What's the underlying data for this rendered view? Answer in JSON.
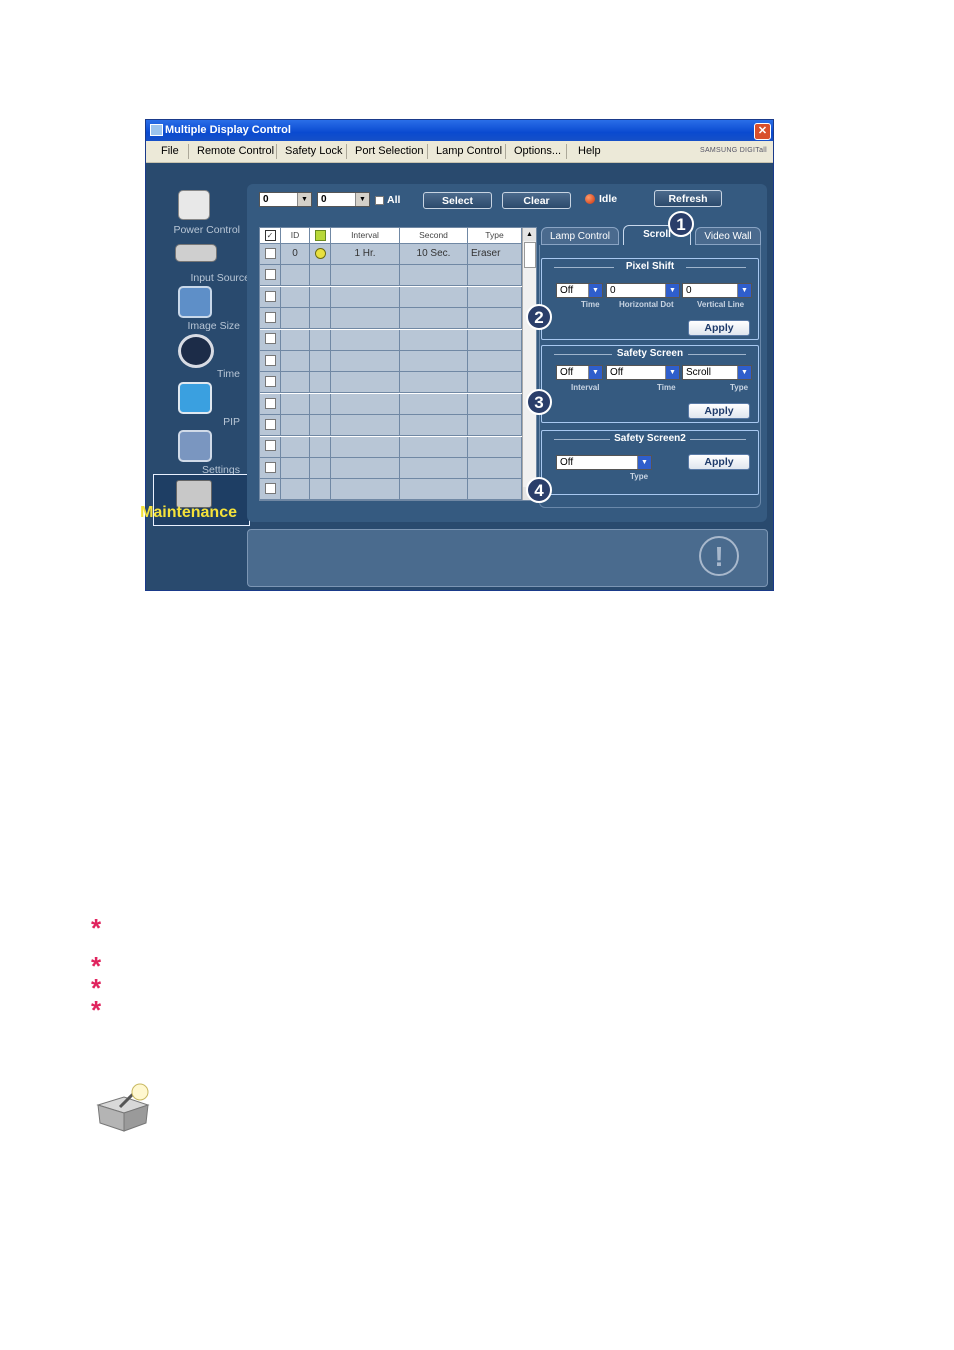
{
  "window": {
    "title": "Multiple Display Control",
    "close_glyph": "✕",
    "brand": "SAMSUNG DIGITall"
  },
  "menu": [
    "File",
    "Remote Control",
    "Safety Lock",
    "Port Selection",
    "Lamp Control",
    "Options...",
    "Help"
  ],
  "sidebar": [
    {
      "label": "Power Control",
      "icon": "power-control-icon"
    },
    {
      "label": "Input Source",
      "icon": "input-source-icon"
    },
    {
      "label": "Image Size",
      "icon": "image-size-icon"
    },
    {
      "label": "Time",
      "icon": "clock-icon"
    },
    {
      "label": "PIP",
      "icon": "pip-icon"
    },
    {
      "label": "Settings",
      "icon": "settings-icon"
    },
    {
      "label": "Maintenance",
      "icon": "maintenance-icon",
      "selected": true
    }
  ],
  "toolbar": {
    "combo1": "0",
    "combo2": "0",
    "all_label": "All",
    "select_label": "Select",
    "clear_label": "Clear",
    "status": "Idle",
    "refresh_label": "Refresh"
  },
  "grid": {
    "columns": [
      "",
      "ID",
      "",
      "Interval",
      "Second",
      "Type"
    ],
    "rows": [
      {
        "id": "0",
        "interval": "1 Hr.",
        "second": "10 Sec.",
        "type": "Eraser"
      }
    ],
    "empty_rows": 11
  },
  "tabs": [
    "Lamp Control",
    "Scroll",
    "Video Wall"
  ],
  "active_tab": "Scroll",
  "pixel_shift": {
    "title": "Pixel Shift",
    "time_value": "Off",
    "time_label": "Time",
    "hdot_value": "0",
    "hdot_label": "Horizontal Dot",
    "vline_value": "0",
    "vline_label": "Vertical Line",
    "apply": "Apply"
  },
  "safety_screen": {
    "title": "Safety Screen",
    "interval_value": "Off",
    "interval_label": "Interval",
    "time_value": "Off",
    "time_label": "Time",
    "type_value": "Scroll",
    "type_label": "Type",
    "apply": "Apply"
  },
  "safety_screen2": {
    "title": "Safety Screen2",
    "type_value": "Off",
    "type_label": "Type",
    "apply": "Apply"
  },
  "callouts": [
    "1",
    "2",
    "3",
    "4"
  ],
  "info_icon": "!",
  "colors": {
    "accent": "#2a6ee8",
    "panel": "#355a80",
    "star": "#e0245e",
    "selected_label": "#f5e23a"
  }
}
